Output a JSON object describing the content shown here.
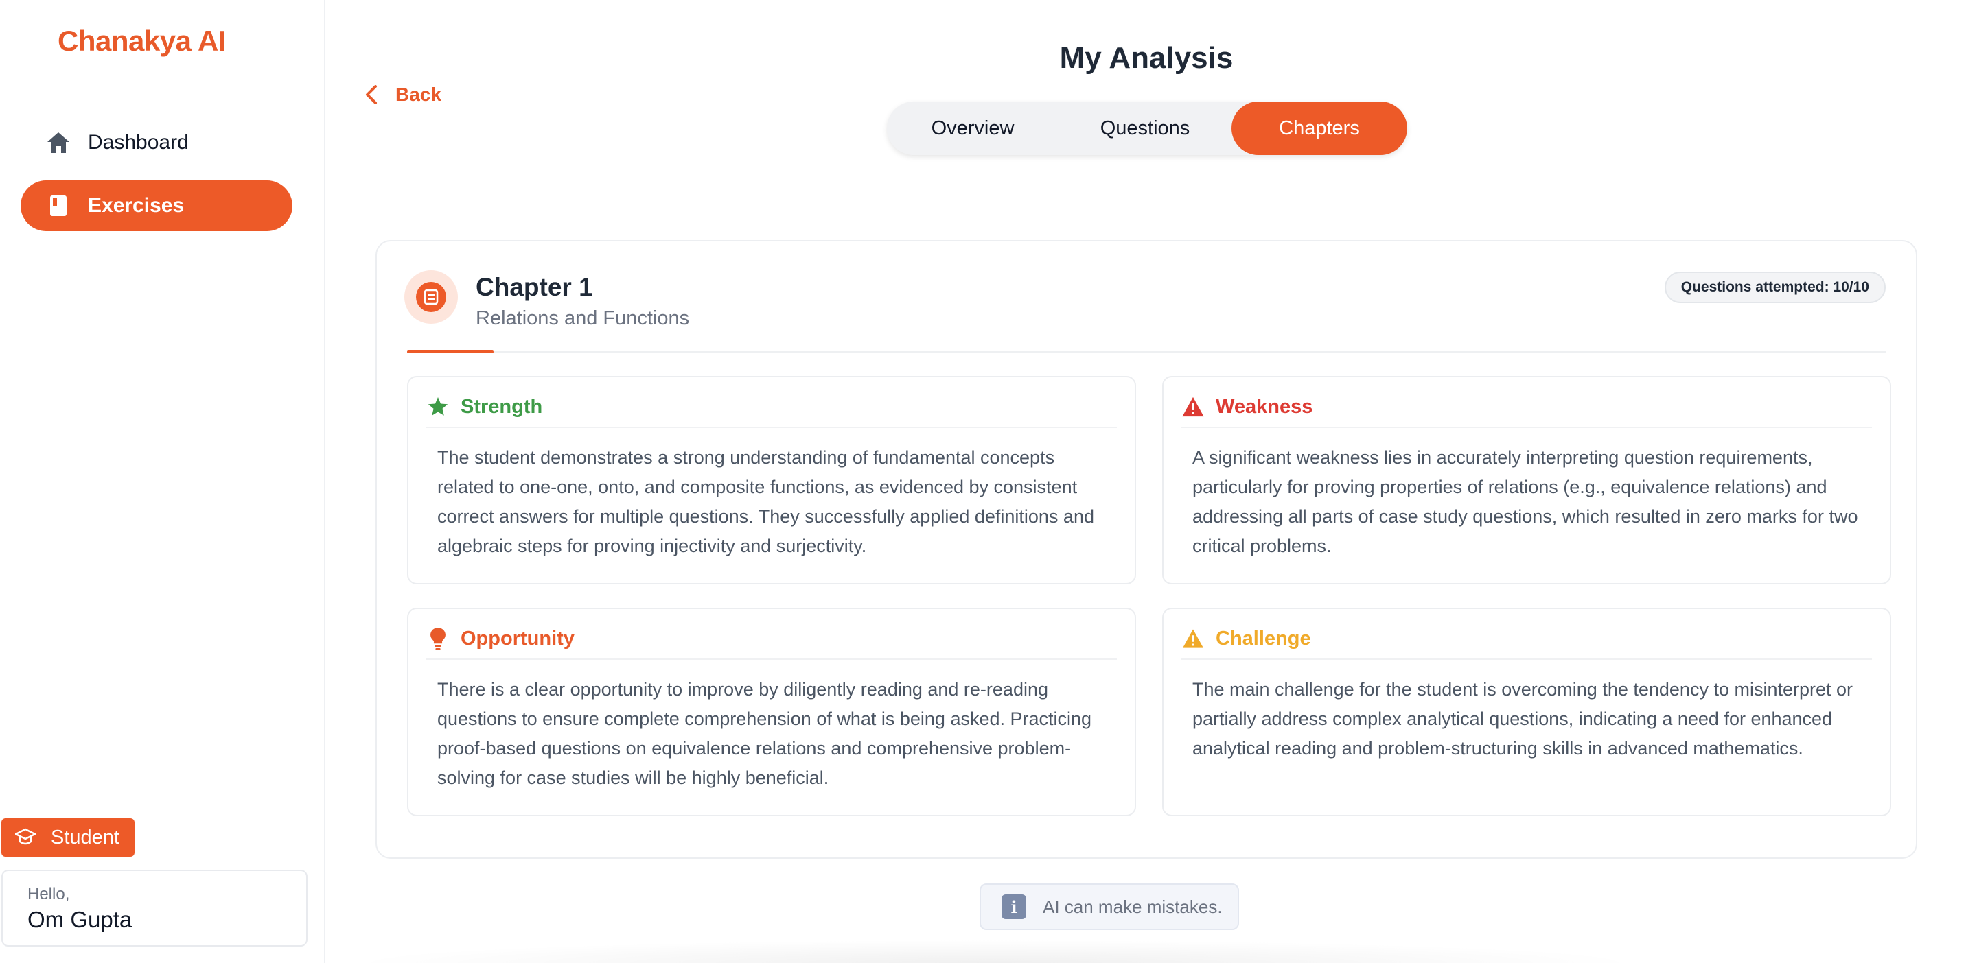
{
  "app": {
    "logo": "Chanakya AI"
  },
  "sidebar": {
    "items": [
      {
        "label": "Dashboard",
        "icon": "home-icon"
      },
      {
        "label": "Exercises",
        "icon": "book-icon",
        "active": true
      }
    ],
    "role_badge": {
      "label": "Student",
      "icon": "graduation-cap-icon"
    },
    "user": {
      "greeting": "Hello,",
      "name": "Om Gupta"
    }
  },
  "header": {
    "back_label": "Back",
    "title": "My Analysis",
    "tabs": [
      {
        "label": "Overview"
      },
      {
        "label": "Questions"
      },
      {
        "label": "Chapters",
        "active": true
      }
    ]
  },
  "chapter": {
    "title": "Chapter 1",
    "subtitle": "Relations and Functions",
    "attempted": "Questions attempted: 10/10",
    "sections": {
      "strength": {
        "label": "Strength",
        "color": "#3e9b47",
        "text": "The student demonstrates a strong understanding of fundamental concepts related to one-one, onto, and composite functions, as evidenced by consistent correct answers for multiple questions. They successfully applied definitions and algebraic steps for proving injectivity and surjectivity."
      },
      "weakness": {
        "label": "Weakness",
        "color": "#dd3b33",
        "text": "A significant weakness lies in accurately interpreting question requirements, particularly for proving properties of relations (e.g., equivalence relations) and addressing all parts of case study questions, which resulted in zero marks for two critical problems."
      },
      "opportunity": {
        "label": "Opportunity",
        "color": "#e85a2a",
        "text": "There is a clear opportunity to improve by diligently reading and re-reading questions to ensure complete comprehension of what is being asked. Practicing proof-based questions on equivalence relations and comprehensive problem-solving for case studies will be highly beneficial."
      },
      "challenge": {
        "label": "Challenge",
        "color": "#f0aa2a",
        "text": "The main challenge for the student is overcoming the tendency to misinterpret or partially address complex analytical questions, indicating a need for enhanced analytical reading and problem-structuring skills in advanced mathematics."
      }
    }
  },
  "footer": {
    "disclaimer": "AI can make mistakes.",
    "disclaimer_icon": "info-icon"
  },
  "colors": {
    "accent": "#ed5a28"
  }
}
